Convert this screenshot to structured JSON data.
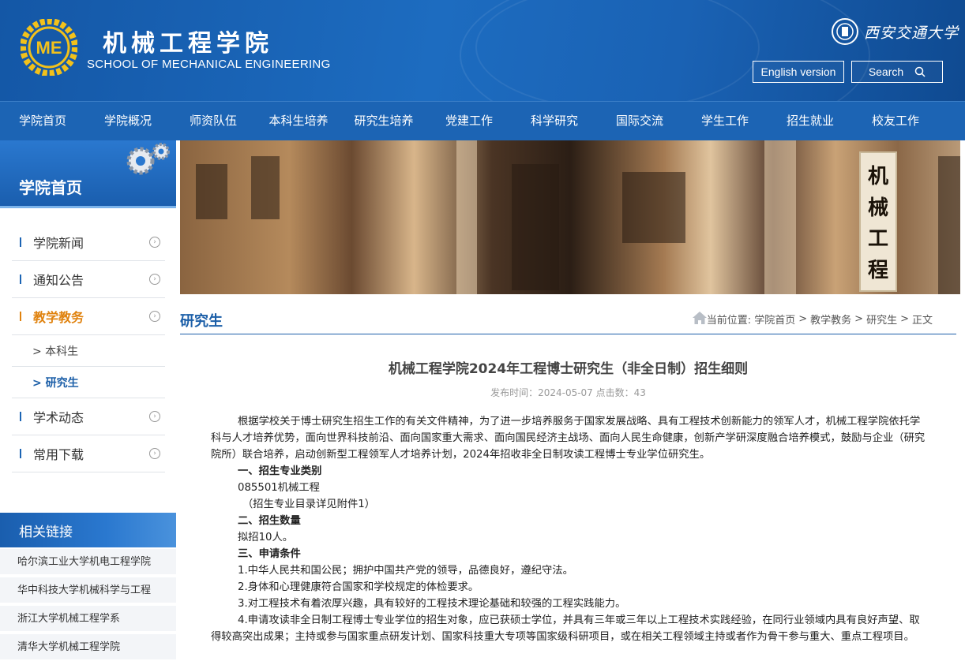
{
  "header": {
    "school_cn": "机械工程学院",
    "school_en": "SCHOOL OF MECHANICAL ENGINEERING",
    "logo_text": "ME",
    "university_name": "西安交通大学",
    "english_version_label": "English version",
    "search_label": "Search"
  },
  "nav": [
    "学院首页",
    "学院概况",
    "师资队伍",
    "本科生培养",
    "研究生培养",
    "党建工作",
    "科学研究",
    "国际交流",
    "学生工作",
    "招生就业",
    "校友工作"
  ],
  "sidebar": {
    "title": "学院首页",
    "menu": [
      {
        "label": "学院新闻"
      },
      {
        "label": "通知公告"
      },
      {
        "label": "教学教务",
        "active": true
      },
      {
        "label": "学术动态"
      },
      {
        "label": "常用下载"
      }
    ],
    "submenu": [
      "> 本科生",
      "> 研究生"
    ],
    "links_title": "相关链接",
    "links": [
      "哈尔滨工业大学机电工程学院",
      "华中科技大学机械科学与工程",
      "浙江大学机械工程学系",
      "清华大学机械工程学院"
    ]
  },
  "banner": {
    "plaque_text": [
      "机",
      "械",
      "工",
      "程"
    ]
  },
  "content": {
    "section_title": "研究生",
    "breadcrumb_prefix": "当前位置:",
    "breadcrumb": [
      "学院首页",
      "教学教务",
      "研究生",
      "正文"
    ],
    "breadcrumb_sep": ">",
    "article_title": "机械工程学院2024年工程博士研究生（非全日制）招生细则",
    "meta": "发布时间：2024-05-07 点击数：43",
    "intro": "根据学校关于博士研究生招生工作的有关文件精神，为了进一步培养服务于国家发展战略、具有工程技术创新能力的领军人才，机械工程学院依托学科与人才培养优势，面向世界科技前沿、面向国家重大需求、面向国民经济主战场、面向人民生命健康，创新产学研深度融合培养模式，鼓励与企业（研究院所）联合培养，启动创新型工程领军人才培养计划，2024年招收非全日制攻读工程博士专业学位研究生。",
    "sec1_title": "一、招生专业类别",
    "sec1_line1": "085501机械工程",
    "sec1_line2": "（招生专业目录详见附件1）",
    "sec2_title": "二、招生数量",
    "sec2_line1": "拟招10人。",
    "sec3_title": "三、申请条件",
    "cond1": "1.中华人民共和国公民；拥护中国共产党的领导，品德良好，遵纪守法。",
    "cond2": "2.身体和心理健康符合国家和学校规定的体检要求。",
    "cond3": "3.对工程技术有着浓厚兴趣，具有较好的工程技术理论基础和较强的工程实践能力。",
    "cond4": "4.申请攻读非全日制工程博士专业学位的招生对象，应已获硕士学位，并具有三年或三年以上工程技术实践经验，在同行业领域内具有良好声望、取得较高突出成果；主持或参与国家重点研发计划、国家科技重大专项等国家级科研项目，或在相关工程领域主持或者作为骨干参与重大、重点工程项目。"
  },
  "colors": {
    "header_blue": "#1c64b4",
    "title_blue": "#1c5fa8",
    "active_orange": "#e0820e"
  }
}
